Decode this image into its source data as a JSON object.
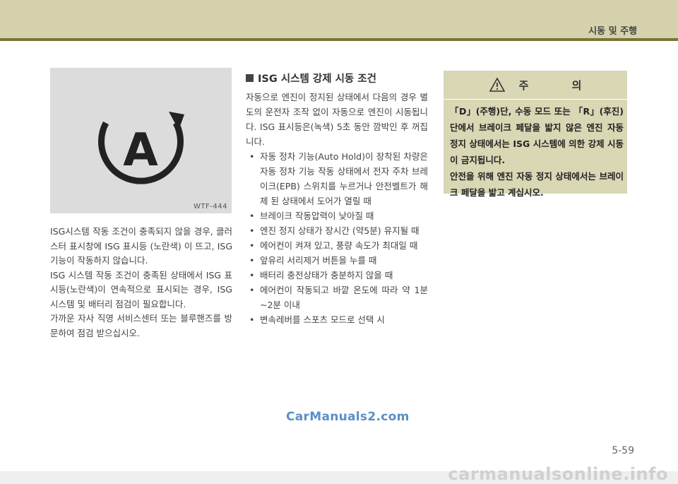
{
  "header": {
    "section_title": "시동 및 주행"
  },
  "figure": {
    "code": "WTF-444",
    "icon": "auto-hold-a-icon",
    "icon_letter": "A"
  },
  "left_text": [
    "ISG시스템 작동 조건이 충족되지 않을 경우, 클러스터 표시창에 ISG 표시등 (노란색) 이 뜨고, ISG 기능이 작동하지 않습니다.",
    "ISG 시스템 작동 조건이 충족된 상태에서 ISG 표시등(노란색)이 연속적으로 표시되는 경우, ISG 시스템 및 배터리 점검이 필요합니다.",
    "가까운 자사 직영 서비스센터 또는 블루핸즈를 방문하여 점검 받으십시오."
  ],
  "middle": {
    "heading": "ISG 시스템 강제 시동 조건",
    "intro": "자동으로 엔진이 정지된 상태에서 다음의 경우 별도의 운전자 조작 없이 자동으로 엔진이 시동됩니다. ISG 표시등은(녹색) 5초 동안 깜박인 후 꺼집니다.",
    "bullets": [
      "자동 정차 기능(Auto Hold)이 장착된 차량은 자동 정차 기능 작동 상태에서 전자 주차 브레이크(EPB) 스위치를 누르거나 안전벨트가 해제 된 상태에서 도어가 열릴 때",
      "브레이크 작동압력이 낮아질 때",
      "엔진 정지 상태가 장시간 (약5분) 유지될 때",
      "에어컨이 켜져 있고, 풍량 속도가 최대일 때",
      "앞유리 서리제거 버튼을 누를 때",
      "배터리 충전상태가 충분하지 않을 때",
      "에어컨이 작동되고 바깥 온도에 따라 약 1분 ~2분 이내",
      "변속레버를 스포츠 모드로 선택 시"
    ]
  },
  "caution": {
    "title": "주 의",
    "icon": "warning-triangle-icon",
    "para1": "「D」(주행)단, 수동 모드 또는 「R」(후진)단에서 브레이크 페달을 밟지 않은 엔진 자동 정지 상태에서는 ISG 시스템에 의한 강제 시동이 금지됩니다.",
    "para2": "안전을 위해 엔진 자동 정지 상태에서는 브레이크 페달을 밟고 계십시오."
  },
  "watermark": "CarManuals2.com",
  "page_number": "5-59",
  "footer_site": "carmanualsonline.info",
  "colors": {
    "header_band": "#d6d2ad",
    "header_line": "#7a7436",
    "caution_bg": "#d9d7b4",
    "watermark": "#5b8fc8"
  }
}
